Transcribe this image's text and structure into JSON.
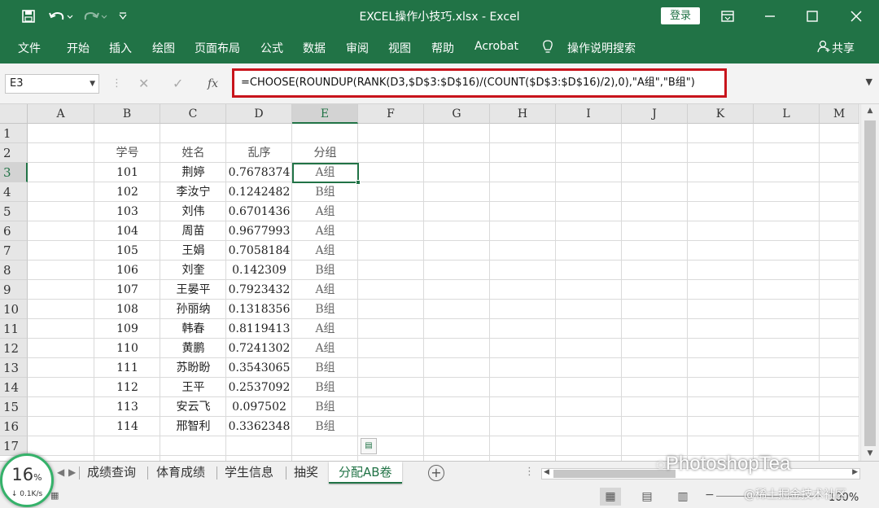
{
  "titlebar": {
    "title": "EXCEL操作小技巧.xlsx  -  Excel",
    "login_label": "登录",
    "save_icon": "save-icon",
    "undo_icon": "undo-icon",
    "redo_icon": "redo-icon",
    "customize_icon": "customize-icon"
  },
  "ribbon": {
    "tabs": [
      "文件",
      "开始",
      "插入",
      "绘图",
      "页面布局",
      "公式",
      "数据",
      "审阅",
      "视图",
      "帮助",
      "Acrobat"
    ],
    "tell_me": "操作说明搜索",
    "share": "共享"
  },
  "formula_bar": {
    "name_box": "E3",
    "fx": "fx",
    "formula": "=CHOOSE(ROUNDUP(RANK(D3,$D$3:$D$16)/(COUNT($D$3:$D$16)/2),0),\"A组\",\"B组\")"
  },
  "columns": [
    "A",
    "B",
    "C",
    "D",
    "E",
    "F",
    "G",
    "H",
    "I",
    "J",
    "K",
    "L",
    "M"
  ],
  "rows": [
    "1",
    "2",
    "3",
    "4",
    "5",
    "6",
    "7",
    "8",
    "9",
    "10",
    "11",
    "12",
    "13",
    "14",
    "15",
    "16",
    "17"
  ],
  "table": {
    "headers": [
      "学号",
      "姓名",
      "乱序",
      "分组"
    ],
    "data": [
      [
        "101",
        "荆婷",
        "0.7678374",
        "A组"
      ],
      [
        "102",
        "李汝宁",
        "0.1242482",
        "B组"
      ],
      [
        "103",
        "刘伟",
        "0.6701436",
        "A组"
      ],
      [
        "104",
        "周苗",
        "0.9677993",
        "A组"
      ],
      [
        "105",
        "王娟",
        "0.7058184",
        "A组"
      ],
      [
        "106",
        "刘奎",
        "0.142309",
        "B组"
      ],
      [
        "107",
        "王晏平",
        "0.7923432",
        "A组"
      ],
      [
        "108",
        "孙丽纳",
        "0.1318356",
        "B组"
      ],
      [
        "109",
        "韩春",
        "0.8119413",
        "A组"
      ],
      [
        "110",
        "黄鹏",
        "0.7241302",
        "A组"
      ],
      [
        "111",
        "苏盼盼",
        "0.3543065",
        "B组"
      ],
      [
        "112",
        "王平",
        "0.2537092",
        "B组"
      ],
      [
        "113",
        "安云飞",
        "0.097502",
        "B组"
      ],
      [
        "114",
        "邢智利",
        "0.3362348",
        "B组"
      ]
    ]
  },
  "sheet_tabs": [
    "成绩查询",
    "体育成绩",
    "学生信息",
    "抽奖",
    "分配AB卷"
  ],
  "active_sheet": "分配AB卷",
  "status": {
    "zoom": "100%",
    "network_percent": "16",
    "network_unit": "%",
    "network_speed": "↓ 0.1K/s"
  },
  "watermark": {
    "line1": "PhotoshopTea",
    "line2": "@稀土掘金技术社区"
  },
  "colors": {
    "excel_green": "#217346",
    "highlight_red": "#c8141c"
  }
}
